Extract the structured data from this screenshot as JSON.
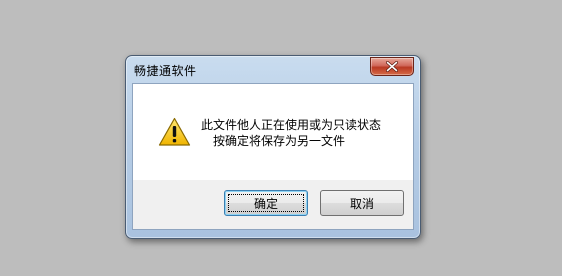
{
  "dialog": {
    "title": "畅捷通软件",
    "message_line1": "此文件他人正在使用或为只读状态",
    "message_line2": "按确定将保存为另一文件",
    "ok_label": "确定",
    "cancel_label": "取消",
    "icon": "warning-icon",
    "close_icon": "close-icon"
  },
  "colors": {
    "desktop_background": "#bdbdbd",
    "close_button": "#c44a30",
    "warning_yellow": "#f5c400"
  }
}
